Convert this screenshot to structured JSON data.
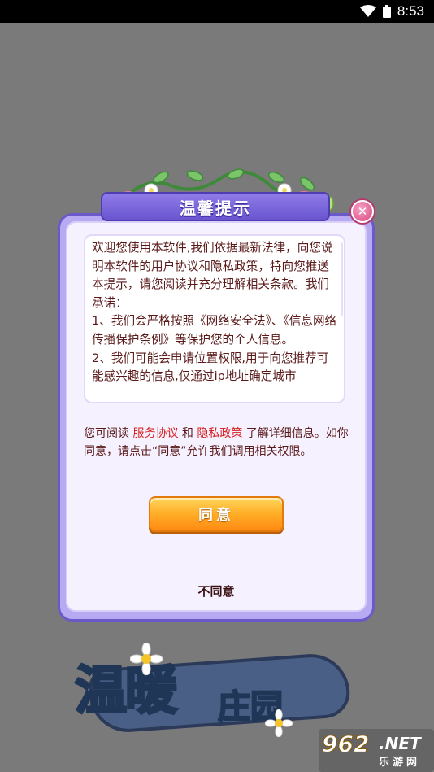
{
  "status_bar": {
    "time": "8:53",
    "wifi_icon": "wifi-icon",
    "battery_icon": "battery-icon"
  },
  "background": {
    "game_title_big": "温暖",
    "game_title_small": "庄园"
  },
  "watermark": {
    "number": "962",
    "domain": ".NET",
    "site_name": "乐游网"
  },
  "dialog": {
    "title": "温馨提示",
    "close_icon": "close-icon",
    "content": "欢迎您使用本软件,我们依据最新法律，向您说明本软件的用户协议和隐私政策，特向您推送本提示，请您阅读并充分理解相关条款。我们承诺：\n1、我们会严格按照《网络安全法》、《信息网络传播保护条例》等保护您的个人信息。\n2、我们可能会申请位置权限,用于向您推荐可能感兴趣的信息,仅通过ip地址确定城市",
    "notice": {
      "prefix": "您可阅读 ",
      "service_link": "服务协议",
      "and": " 和 ",
      "privacy_link": "隐私政策",
      "suffix": " 了解详细信息。如你同意，请点击“同意”允许我们调用相关权限。"
    },
    "agree_label": "同意",
    "disagree_label": "不同意"
  },
  "colors": {
    "backdrop": "#7a7a7a",
    "dialog_frame": "#6a59c8",
    "dialog_body": "#f6f1ff",
    "title_plate": "#7e69e0",
    "text": "#5a1a1a",
    "link": "#d81e1e",
    "agree_button": "#ffad27",
    "close_button": "#d9437f"
  }
}
